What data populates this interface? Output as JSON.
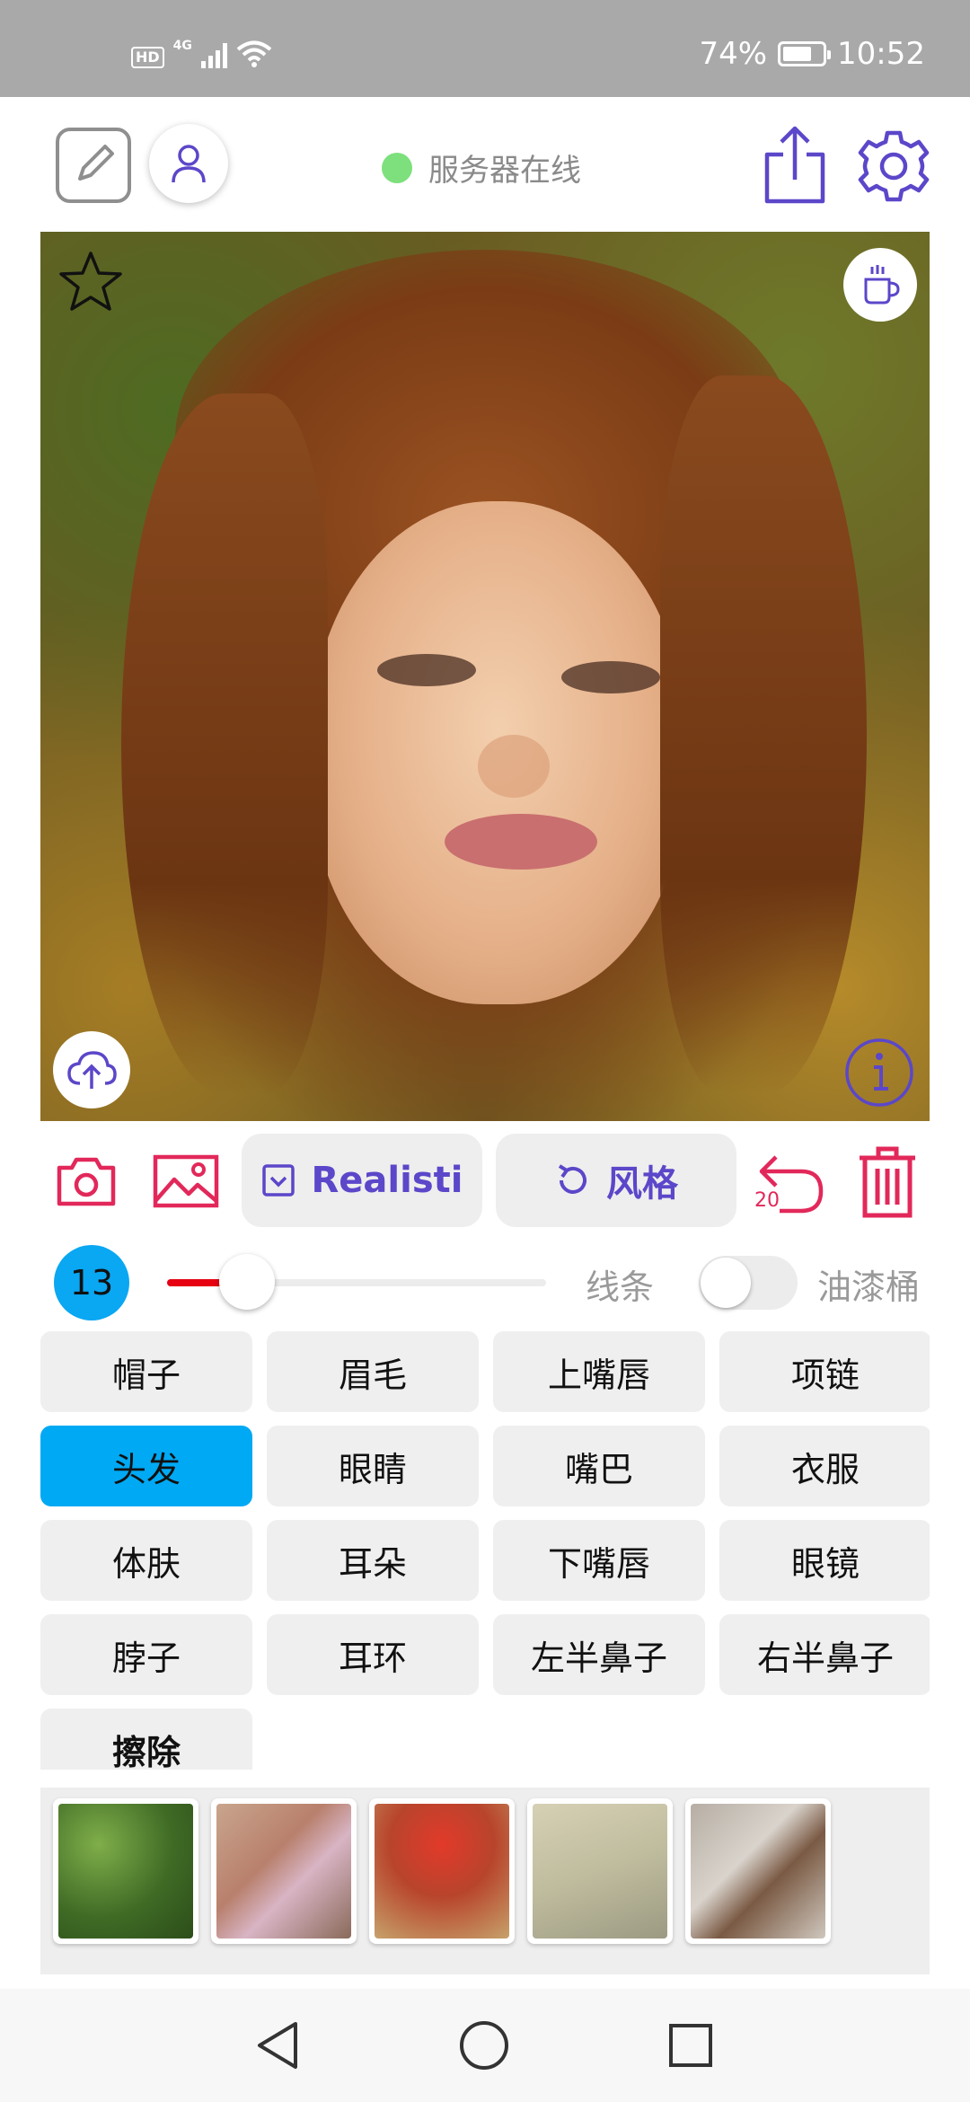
{
  "status_bar": {
    "hd": "HD",
    "network": "4G",
    "battery_percent": "74%",
    "battery_level": 0.74,
    "time": "10:52"
  },
  "header": {
    "server_status": "服务器在线",
    "server_status_color": "#7de07d"
  },
  "actions": {
    "model_label": "Realisti",
    "style_label": "风格",
    "undo_count": "20",
    "accent_purple": "#5b47c9",
    "accent_red": "#e2285a"
  },
  "brush": {
    "size": "13",
    "slider_fraction": 0.21,
    "line_label": "线条",
    "bucket_label": "油漆桶",
    "bucket_enabled": false
  },
  "parts": {
    "items": [
      {
        "label": "帽子",
        "active": false
      },
      {
        "label": "眉毛",
        "active": false
      },
      {
        "label": "上嘴唇",
        "active": false
      },
      {
        "label": "项链",
        "active": false
      },
      {
        "label": "头发",
        "active": true
      },
      {
        "label": "眼睛",
        "active": false
      },
      {
        "label": "嘴巴",
        "active": false
      },
      {
        "label": "衣服",
        "active": false
      },
      {
        "label": "体肤",
        "active": false
      },
      {
        "label": "耳朵",
        "active": false
      },
      {
        "label": "下嘴唇",
        "active": false
      },
      {
        "label": "眼镜",
        "active": false
      },
      {
        "label": "脖子",
        "active": false
      },
      {
        "label": "耳环",
        "active": false
      },
      {
        "label": "左半鼻子",
        "active": false
      },
      {
        "label": "右半鼻子",
        "active": false
      },
      {
        "label": "擦除",
        "active": false
      }
    ],
    "active_color": "#00a9f4"
  },
  "textures": [
    "green-foliage",
    "pink-crystals",
    "red-flowers",
    "beige-stone",
    "grey-fabric"
  ],
  "icons": {
    "edit": "edit-square-icon",
    "user": "user-icon",
    "share": "share-icon",
    "settings": "gear-icon",
    "favorite": "star-icon",
    "coffee": "coffee-cup-icon",
    "upload": "cloud-upload-icon",
    "info": "info-icon",
    "camera": "camera-icon",
    "gallery": "image-icon",
    "undo": "undo-icon",
    "trash": "trash-icon"
  }
}
